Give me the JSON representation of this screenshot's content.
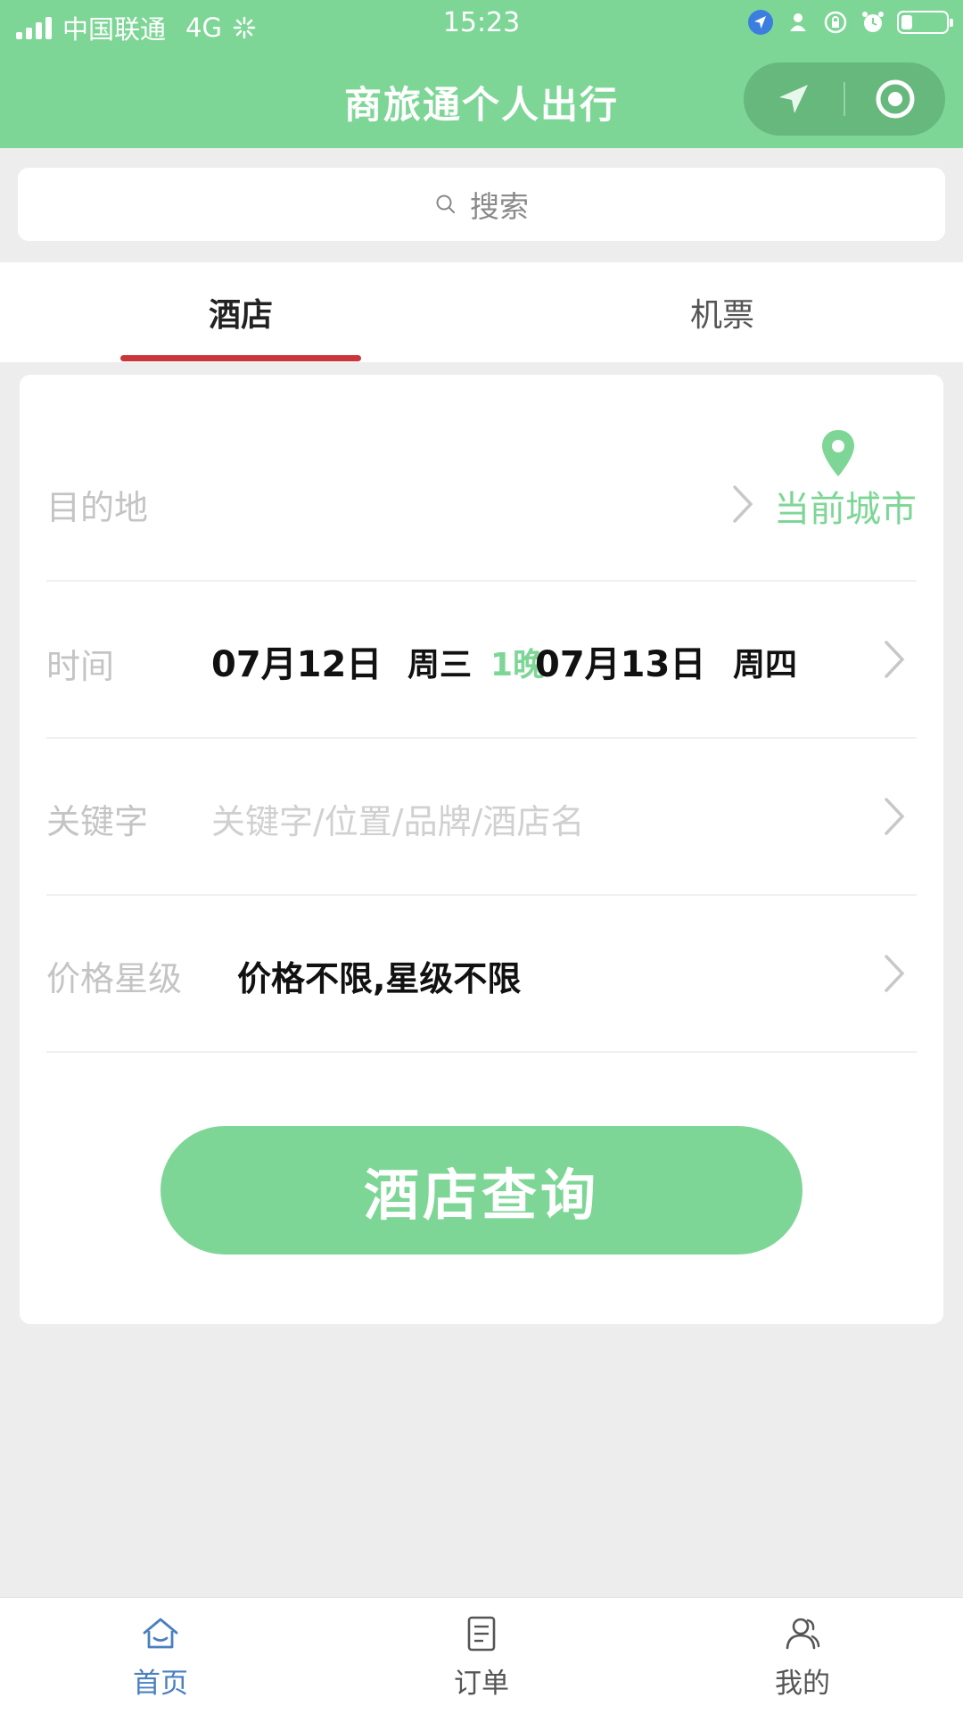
{
  "status_bar": {
    "carrier": "中国联通",
    "network": "4G",
    "time": "15:23"
  },
  "nav": {
    "title": "商旅通个人出行"
  },
  "search": {
    "placeholder": "搜索"
  },
  "tabs": [
    {
      "label": "酒店",
      "active": true
    },
    {
      "label": "机票",
      "active": false
    }
  ],
  "form": {
    "destination": {
      "label": "目的地",
      "current_city": "当前城市"
    },
    "time": {
      "label": "时间",
      "check_in_date": "07月12日",
      "check_in_weekday": "周三",
      "nights": "1晚",
      "check_out_date": "07月13日",
      "check_out_weekday": "周四"
    },
    "keyword": {
      "label": "关键字",
      "placeholder": "关键字/位置/品牌/酒店名"
    },
    "price_star": {
      "label": "价格星级",
      "value": "价格不限,星级不限"
    },
    "submit_label": "酒店查询"
  },
  "tabbar": [
    {
      "label": "首页",
      "icon": "home-icon",
      "active": true
    },
    {
      "label": "订单",
      "icon": "order-icon",
      "active": false
    },
    {
      "label": "我的",
      "icon": "profile-icon",
      "active": false
    }
  ],
  "colors": {
    "brand": "#7dd696",
    "tab_indicator": "#c9373a",
    "tabbar_active": "#4a7fc0"
  }
}
